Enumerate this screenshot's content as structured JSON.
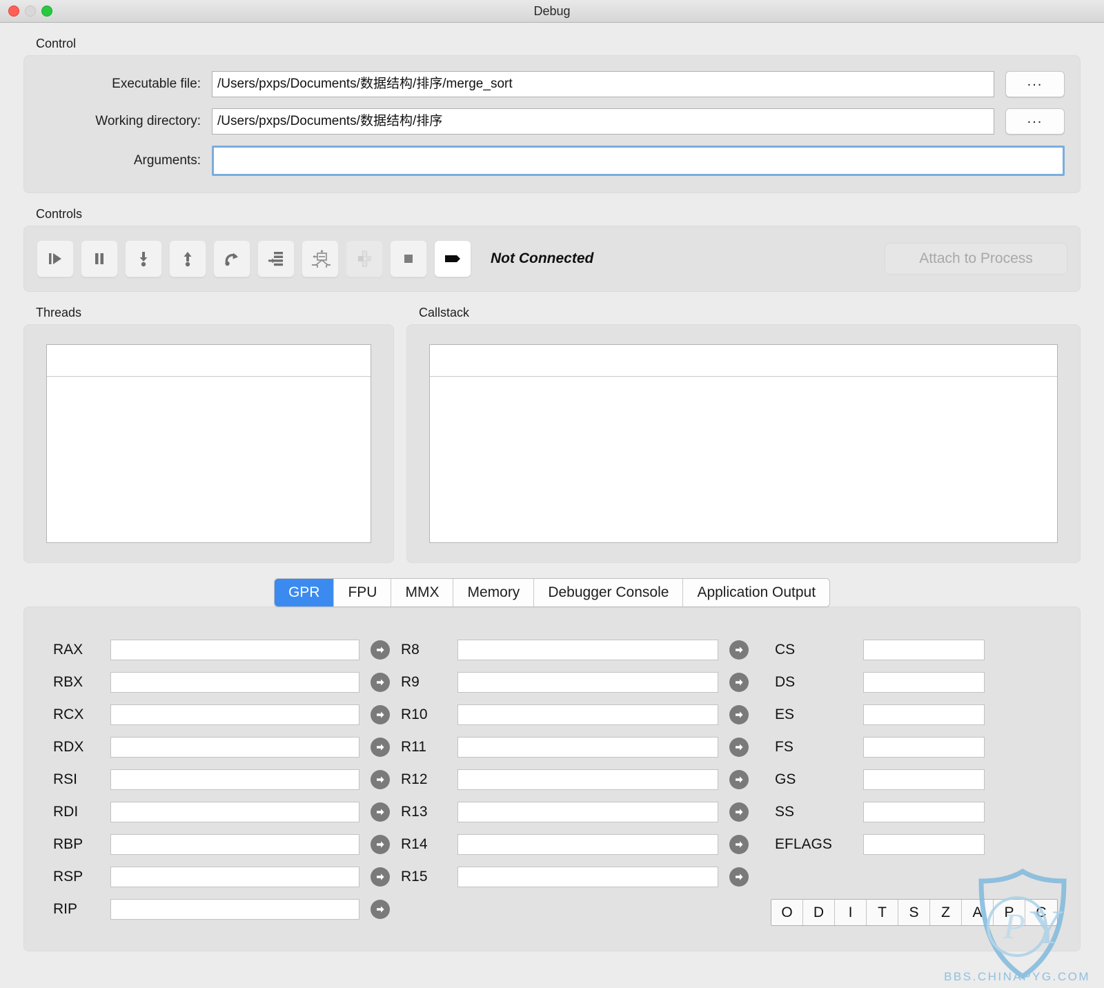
{
  "window": {
    "title": "Debug",
    "traffic_lights": [
      "close-button",
      "minimize-button",
      "zoom-button"
    ]
  },
  "control": {
    "group_label": "Control",
    "fields": [
      {
        "label": "Executable file:",
        "value": "/Users/pxps/Documents/数据结构/排序/merge_sort",
        "placeholder": "",
        "browse_label": "...",
        "focused": false
      },
      {
        "label": "Working directory:",
        "value": "/Users/pxps/Documents/数据结构/排序",
        "placeholder": "",
        "browse_label": "...",
        "focused": false
      },
      {
        "label": "Arguments:",
        "value": "",
        "placeholder": "",
        "browse_label": "",
        "focused": true
      }
    ]
  },
  "controls": {
    "group_label": "Controls",
    "buttons": [
      {
        "name": "run-icon",
        "enabled": true,
        "style": "normal"
      },
      {
        "name": "pause-icon",
        "enabled": true,
        "style": "normal"
      },
      {
        "name": "step-into-icon",
        "enabled": true,
        "style": "normal"
      },
      {
        "name": "step-out-icon",
        "enabled": true,
        "style": "normal"
      },
      {
        "name": "step-over-icon",
        "enabled": true,
        "style": "normal"
      },
      {
        "name": "step-instruction-icon",
        "enabled": true,
        "style": "normal"
      },
      {
        "name": "run-to-cursor-icon",
        "enabled": true,
        "style": "normal"
      },
      {
        "name": "detach-icon",
        "enabled": false,
        "style": "normal"
      },
      {
        "name": "stop-icon",
        "enabled": true,
        "style": "normal"
      },
      {
        "name": "breakpoint-icon",
        "enabled": true,
        "style": "white"
      }
    ],
    "status": "Not Connected",
    "attach_label": "Attach to Process",
    "attach_enabled": false
  },
  "panels": {
    "threads": {
      "label": "Threads",
      "rows": []
    },
    "callstack": {
      "label": "Callstack",
      "rows": []
    }
  },
  "tabs": [
    {
      "label": "GPR",
      "active": true
    },
    {
      "label": "FPU",
      "active": false
    },
    {
      "label": "MMX",
      "active": false
    },
    {
      "label": "Memory",
      "active": false
    },
    {
      "label": "Debugger Console",
      "active": false
    },
    {
      "label": "Application Output",
      "active": false
    }
  ],
  "registers": {
    "column1": [
      {
        "name": "RAX",
        "value": ""
      },
      {
        "name": "RBX",
        "value": ""
      },
      {
        "name": "RCX",
        "value": ""
      },
      {
        "name": "RDX",
        "value": ""
      },
      {
        "name": "RSI",
        "value": ""
      },
      {
        "name": "RDI",
        "value": ""
      },
      {
        "name": "RBP",
        "value": ""
      },
      {
        "name": "RSP",
        "value": ""
      },
      {
        "name": "RIP",
        "value": ""
      }
    ],
    "column2": [
      {
        "name": "R8",
        "value": ""
      },
      {
        "name": "R9",
        "value": ""
      },
      {
        "name": "R10",
        "value": ""
      },
      {
        "name": "R11",
        "value": ""
      },
      {
        "name": "R12",
        "value": ""
      },
      {
        "name": "R13",
        "value": ""
      },
      {
        "name": "R14",
        "value": ""
      },
      {
        "name": "R15",
        "value": ""
      }
    ],
    "column3": [
      {
        "name": "CS",
        "value": ""
      },
      {
        "name": "DS",
        "value": ""
      },
      {
        "name": "ES",
        "value": ""
      },
      {
        "name": "FS",
        "value": ""
      },
      {
        "name": "GS",
        "value": ""
      },
      {
        "name": "SS",
        "value": ""
      },
      {
        "name": "EFLAGS",
        "value": ""
      }
    ],
    "flags": [
      "O",
      "D",
      "I",
      "T",
      "S",
      "Z",
      "A",
      "P",
      "C"
    ]
  },
  "watermark": {
    "text": "BBS.CHINAPYG.COM",
    "logo": "pyg-shield-logo",
    "color": "#8fc0e0"
  },
  "colors": {
    "accent": "#3b8af0",
    "focus_ring": "#7aadde",
    "window_bg": "#ececec",
    "group_bg": "#e2e2e2",
    "arrow_button": "#7a7a7a"
  }
}
